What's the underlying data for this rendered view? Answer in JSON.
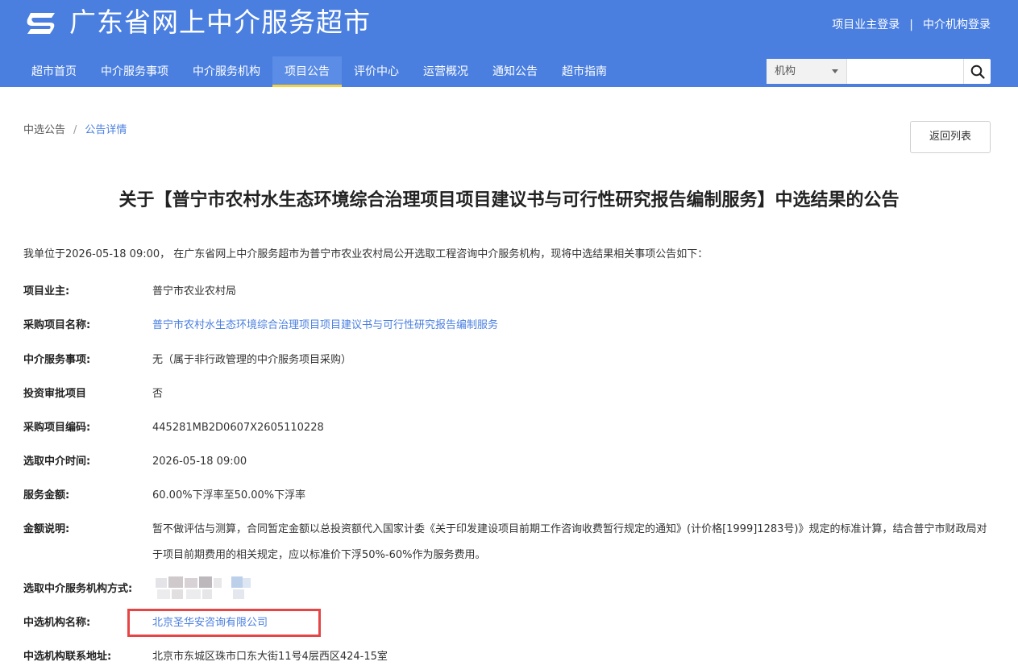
{
  "header": {
    "site_title": "广东省网上中介服务超市",
    "login_owner": "项目业主登录",
    "login_separator": "|",
    "login_agency": "中介机构登录"
  },
  "nav": {
    "items": [
      "超市首页",
      "中介服务事项",
      "中介服务机构",
      "项目公告",
      "评价中心",
      "运营概况",
      "通知公告",
      "超市指南"
    ],
    "active_index": 3
  },
  "search": {
    "select_value": "机构",
    "input_value": ""
  },
  "breadcrumb": {
    "parent": "中选公告",
    "separator": "/",
    "current": "公告详情"
  },
  "back_button": "返回列表",
  "announcement": {
    "title": "关于【普宁市农村水生态环境综合治理项目项目建议书与可行性研究报告编制服务】中选结果的公告",
    "intro": "我单位于2026-05-18 09:00， 在广东省网上中介服务超市为普宁市农业农村局公开选取工程咨询中介服务机构，现将中选结果相关事项公告如下：",
    "fields": [
      {
        "label": "项目业主:",
        "value": "普宁市农业农村局"
      },
      {
        "label": "采购项目名称:",
        "value": "普宁市农村水生态环境综合治理项目项目建议书与可行性研究报告编制服务"
      },
      {
        "label": "中介服务事项:",
        "value": "无（属于非行政管理的中介服务项目采购）"
      },
      {
        "label": "投资审批项目",
        "value": "否"
      },
      {
        "label": "采购项目编码:",
        "value": "445281MB2D0607X2605110228"
      },
      {
        "label": "选取中介时间:",
        "value": "2026-05-18 09:00"
      },
      {
        "label": "服务金额:",
        "value": "60.00%下浮率至50.00%下浮率"
      },
      {
        "label": "金额说明:",
        "value": "暂不做评估与测算，合同暂定金额以总投资额代入国家计委《关于印发建设项目前期工作咨询收费暂行规定的通知》(计价格[1999]1283号)》规定的标准计算，结合普宁市财政局对于项目前期费用的相关规定，应以标准价下浮50%-60%作为服务费用。"
      },
      {
        "label": "选取中介服务机构方式:",
        "value": ""
      },
      {
        "label": "中选机构名称:",
        "value": "北京圣华安咨询有限公司"
      },
      {
        "label": "中选机构联系地址:",
        "value": "北京市东城区珠市口东大街11号4层西区424-15室"
      }
    ]
  },
  "colors": {
    "header_bg": "#4a7fe0",
    "link": "#4a7fe0",
    "nav_active_underline": "#f5d142",
    "highlight_border": "#e64545"
  }
}
